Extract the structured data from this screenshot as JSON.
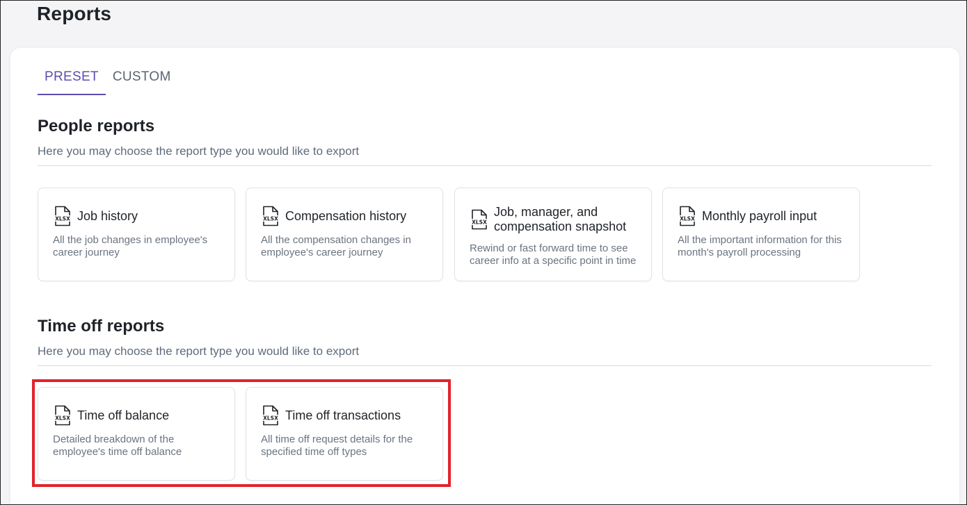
{
  "page": {
    "title": "Reports"
  },
  "tabs": [
    {
      "label": "PRESET",
      "active": true
    },
    {
      "label": "CUSTOM",
      "active": false
    }
  ],
  "sections": [
    {
      "title": "People reports",
      "subtitle": "Here you may choose the report type you would like to export",
      "cards": [
        {
          "icon": "xlsx-file-icon",
          "title": "Job history",
          "description": "All the job changes in employee's career journey"
        },
        {
          "icon": "xlsx-file-icon",
          "title": "Compensation history",
          "description": "All the compensation changes in employee's career journey"
        },
        {
          "icon": "xlsx-file-icon",
          "title": "Job, manager, and compensation snapshot",
          "description": "Rewind or fast forward time to see career info at a specific point in time"
        },
        {
          "icon": "xlsx-file-icon",
          "title": "Monthly payroll input",
          "description": "All the important information for this month's payroll processing"
        }
      ]
    },
    {
      "title": "Time off reports",
      "subtitle": "Here you may choose the report type you would like to export",
      "cards": [
        {
          "icon": "xlsx-file-icon",
          "title": "Time off balance",
          "description": "Detailed breakdown of the employee's time off balance"
        },
        {
          "icon": "xlsx-file-icon",
          "title": "Time off transactions",
          "description": "All time off request details for the specified time off types"
        }
      ]
    }
  ],
  "icon_text": "XLSX",
  "colors": {
    "accent": "#5a4fb0",
    "highlight": "#e3222b"
  }
}
